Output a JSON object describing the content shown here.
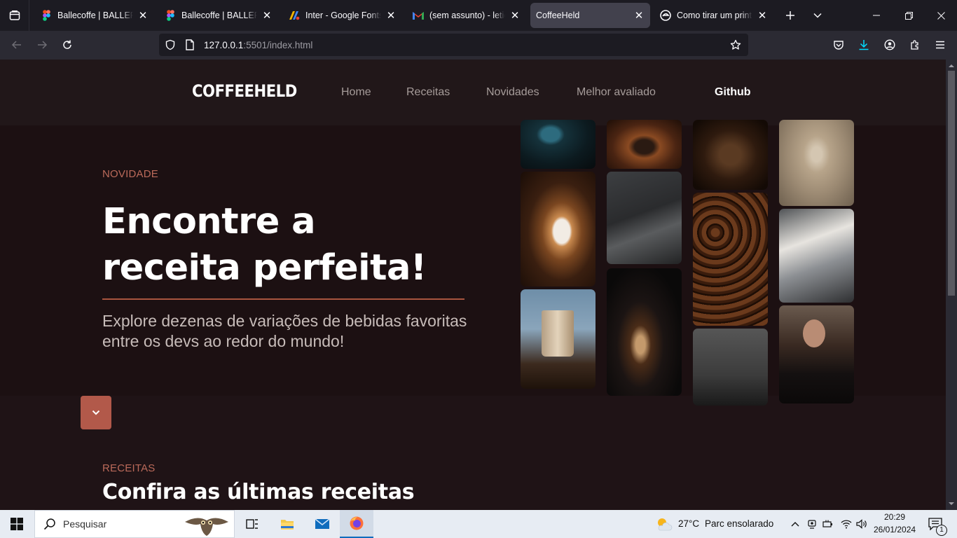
{
  "browser": {
    "tabs": [
      {
        "title": "Ballecoffe | BALLERINE",
        "favicon": "figma-icon",
        "active": false
      },
      {
        "title": "Ballecoffe | BALLERINE",
        "favicon": "figma-icon",
        "active": false
      },
      {
        "title": "Inter - Google Fonts",
        "favicon": "google-fonts-icon",
        "active": false
      },
      {
        "title": "(sem assunto) - leticiag",
        "favicon": "gmail-icon",
        "active": false
      },
      {
        "title": "CoffeeHeld",
        "favicon": "",
        "active": true
      },
      {
        "title": "Como tirar um print sc",
        "favicon": "edge-icon",
        "active": false
      }
    ],
    "url": {
      "host": "127.0.0.1",
      "rest": ":5501/index.html"
    }
  },
  "site": {
    "logo": "COFFEEHELD",
    "menu": [
      "Home",
      "Receitas",
      "Novidades",
      "Melhor avaliado"
    ],
    "github": "Github",
    "hero": {
      "eyebrow": "NOVIDADE",
      "title_line1": "Encontre a",
      "title_line2": "receita perfeita!",
      "subtitle": "Explore dezenas de variações de bebidas favoritas entre os devs ao redor do mundo!"
    },
    "recipes": {
      "eyebrow": "RECEITAS",
      "title": "Confira as últimas receitas"
    }
  },
  "taskbar": {
    "search_placeholder": "Pesquisar",
    "weather_temp": "27°C",
    "weather_desc": "Parc ensolarado",
    "time": "20:29",
    "date": "26/01/2024",
    "notifications": "1"
  },
  "colors": {
    "accent": "#b2594a",
    "eyebrow": "#bb6a5a",
    "page_bg": "#1c1012",
    "header_bg": "#211719"
  }
}
